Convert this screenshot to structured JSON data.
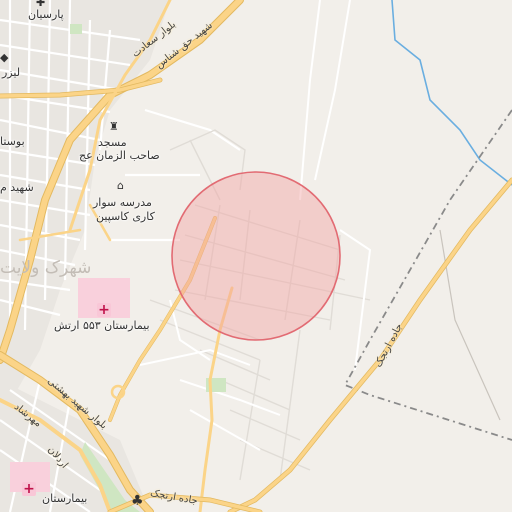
{
  "map": {
    "labels": {
      "parsian": "پارسیان",
      "laser": "لیزر",
      "boostan": "بوستا",
      "shahid_m": "شهید م",
      "mosque_line1": "مسجد",
      "mosque_line2": "صاحب الزمان عج",
      "school_line1": "مدرسه سوار",
      "school_line2": "کاری کاسپین",
      "district": "شهرک ولایت",
      "hospital_553": "بیمارستان ۵۵۳ ارتش",
      "hospital_bottom": "بیمارستان",
      "street_sanati": "بلوار سعادت",
      "street_haghshenas": "شهید حق شناس",
      "street_beheshti": "بلوار شهید بهشتی",
      "street_arjak": "جاده ارتجک",
      "street_arjak_bottom": "جاده ارتجک",
      "street_ardalan": "اردلان",
      "street_mehrzad": "مهرشاد"
    },
    "highlight_circle": {
      "fill": "#f2a4a4",
      "stroke": "#e26b73"
    },
    "colors": {
      "background": "#f2efea",
      "major_road": "#fbd488",
      "hospital_area": "#f9d0dc",
      "water": "#6aaee0",
      "boundary": "#8a8a8a"
    }
  }
}
